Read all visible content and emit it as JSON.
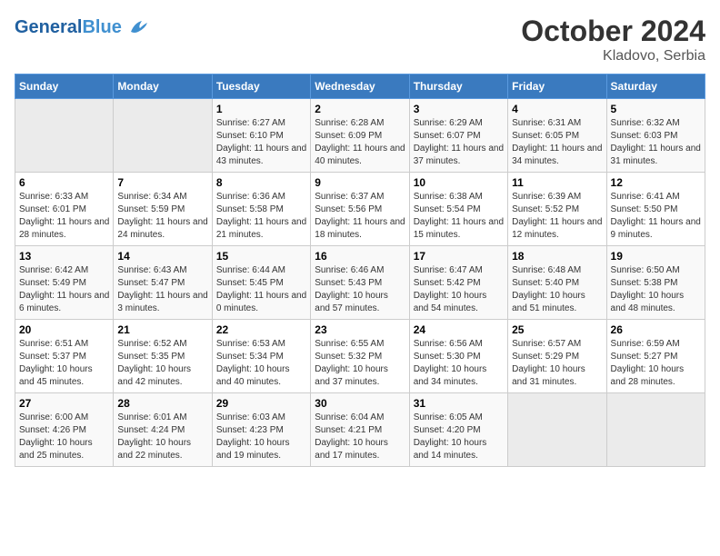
{
  "logo": {
    "general": "General",
    "blue": "Blue"
  },
  "header": {
    "month": "October 2024",
    "location": "Kladovo, Serbia"
  },
  "weekdays": [
    "Sunday",
    "Monday",
    "Tuesday",
    "Wednesday",
    "Thursday",
    "Friday",
    "Saturday"
  ],
  "weeks": [
    [
      {
        "day": "",
        "sunrise": "",
        "sunset": "",
        "daylight": ""
      },
      {
        "day": "",
        "sunrise": "",
        "sunset": "",
        "daylight": ""
      },
      {
        "day": "1",
        "sunrise": "Sunrise: 6:27 AM",
        "sunset": "Sunset: 6:10 PM",
        "daylight": "Daylight: 11 hours and 43 minutes."
      },
      {
        "day": "2",
        "sunrise": "Sunrise: 6:28 AM",
        "sunset": "Sunset: 6:09 PM",
        "daylight": "Daylight: 11 hours and 40 minutes."
      },
      {
        "day": "3",
        "sunrise": "Sunrise: 6:29 AM",
        "sunset": "Sunset: 6:07 PM",
        "daylight": "Daylight: 11 hours and 37 minutes."
      },
      {
        "day": "4",
        "sunrise": "Sunrise: 6:31 AM",
        "sunset": "Sunset: 6:05 PM",
        "daylight": "Daylight: 11 hours and 34 minutes."
      },
      {
        "day": "5",
        "sunrise": "Sunrise: 6:32 AM",
        "sunset": "Sunset: 6:03 PM",
        "daylight": "Daylight: 11 hours and 31 minutes."
      }
    ],
    [
      {
        "day": "6",
        "sunrise": "Sunrise: 6:33 AM",
        "sunset": "Sunset: 6:01 PM",
        "daylight": "Daylight: 11 hours and 28 minutes."
      },
      {
        "day": "7",
        "sunrise": "Sunrise: 6:34 AM",
        "sunset": "Sunset: 5:59 PM",
        "daylight": "Daylight: 11 hours and 24 minutes."
      },
      {
        "day": "8",
        "sunrise": "Sunrise: 6:36 AM",
        "sunset": "Sunset: 5:58 PM",
        "daylight": "Daylight: 11 hours and 21 minutes."
      },
      {
        "day": "9",
        "sunrise": "Sunrise: 6:37 AM",
        "sunset": "Sunset: 5:56 PM",
        "daylight": "Daylight: 11 hours and 18 minutes."
      },
      {
        "day": "10",
        "sunrise": "Sunrise: 6:38 AM",
        "sunset": "Sunset: 5:54 PM",
        "daylight": "Daylight: 11 hours and 15 minutes."
      },
      {
        "day": "11",
        "sunrise": "Sunrise: 6:39 AM",
        "sunset": "Sunset: 5:52 PM",
        "daylight": "Daylight: 11 hours and 12 minutes."
      },
      {
        "day": "12",
        "sunrise": "Sunrise: 6:41 AM",
        "sunset": "Sunset: 5:50 PM",
        "daylight": "Daylight: 11 hours and 9 minutes."
      }
    ],
    [
      {
        "day": "13",
        "sunrise": "Sunrise: 6:42 AM",
        "sunset": "Sunset: 5:49 PM",
        "daylight": "Daylight: 11 hours and 6 minutes."
      },
      {
        "day": "14",
        "sunrise": "Sunrise: 6:43 AM",
        "sunset": "Sunset: 5:47 PM",
        "daylight": "Daylight: 11 hours and 3 minutes."
      },
      {
        "day": "15",
        "sunrise": "Sunrise: 6:44 AM",
        "sunset": "Sunset: 5:45 PM",
        "daylight": "Daylight: 11 hours and 0 minutes."
      },
      {
        "day": "16",
        "sunrise": "Sunrise: 6:46 AM",
        "sunset": "Sunset: 5:43 PM",
        "daylight": "Daylight: 10 hours and 57 minutes."
      },
      {
        "day": "17",
        "sunrise": "Sunrise: 6:47 AM",
        "sunset": "Sunset: 5:42 PM",
        "daylight": "Daylight: 10 hours and 54 minutes."
      },
      {
        "day": "18",
        "sunrise": "Sunrise: 6:48 AM",
        "sunset": "Sunset: 5:40 PM",
        "daylight": "Daylight: 10 hours and 51 minutes."
      },
      {
        "day": "19",
        "sunrise": "Sunrise: 6:50 AM",
        "sunset": "Sunset: 5:38 PM",
        "daylight": "Daylight: 10 hours and 48 minutes."
      }
    ],
    [
      {
        "day": "20",
        "sunrise": "Sunrise: 6:51 AM",
        "sunset": "Sunset: 5:37 PM",
        "daylight": "Daylight: 10 hours and 45 minutes."
      },
      {
        "day": "21",
        "sunrise": "Sunrise: 6:52 AM",
        "sunset": "Sunset: 5:35 PM",
        "daylight": "Daylight: 10 hours and 42 minutes."
      },
      {
        "day": "22",
        "sunrise": "Sunrise: 6:53 AM",
        "sunset": "Sunset: 5:34 PM",
        "daylight": "Daylight: 10 hours and 40 minutes."
      },
      {
        "day": "23",
        "sunrise": "Sunrise: 6:55 AM",
        "sunset": "Sunset: 5:32 PM",
        "daylight": "Daylight: 10 hours and 37 minutes."
      },
      {
        "day": "24",
        "sunrise": "Sunrise: 6:56 AM",
        "sunset": "Sunset: 5:30 PM",
        "daylight": "Daylight: 10 hours and 34 minutes."
      },
      {
        "day": "25",
        "sunrise": "Sunrise: 6:57 AM",
        "sunset": "Sunset: 5:29 PM",
        "daylight": "Daylight: 10 hours and 31 minutes."
      },
      {
        "day": "26",
        "sunrise": "Sunrise: 6:59 AM",
        "sunset": "Sunset: 5:27 PM",
        "daylight": "Daylight: 10 hours and 28 minutes."
      }
    ],
    [
      {
        "day": "27",
        "sunrise": "Sunrise: 6:00 AM",
        "sunset": "Sunset: 4:26 PM",
        "daylight": "Daylight: 10 hours and 25 minutes."
      },
      {
        "day": "28",
        "sunrise": "Sunrise: 6:01 AM",
        "sunset": "Sunset: 4:24 PM",
        "daylight": "Daylight: 10 hours and 22 minutes."
      },
      {
        "day": "29",
        "sunrise": "Sunrise: 6:03 AM",
        "sunset": "Sunset: 4:23 PM",
        "daylight": "Daylight: 10 hours and 19 minutes."
      },
      {
        "day": "30",
        "sunrise": "Sunrise: 6:04 AM",
        "sunset": "Sunset: 4:21 PM",
        "daylight": "Daylight: 10 hours and 17 minutes."
      },
      {
        "day": "31",
        "sunrise": "Sunrise: 6:05 AM",
        "sunset": "Sunset: 4:20 PM",
        "daylight": "Daylight: 10 hours and 14 minutes."
      },
      {
        "day": "",
        "sunrise": "",
        "sunset": "",
        "daylight": ""
      },
      {
        "day": "",
        "sunrise": "",
        "sunset": "",
        "daylight": ""
      }
    ]
  ]
}
